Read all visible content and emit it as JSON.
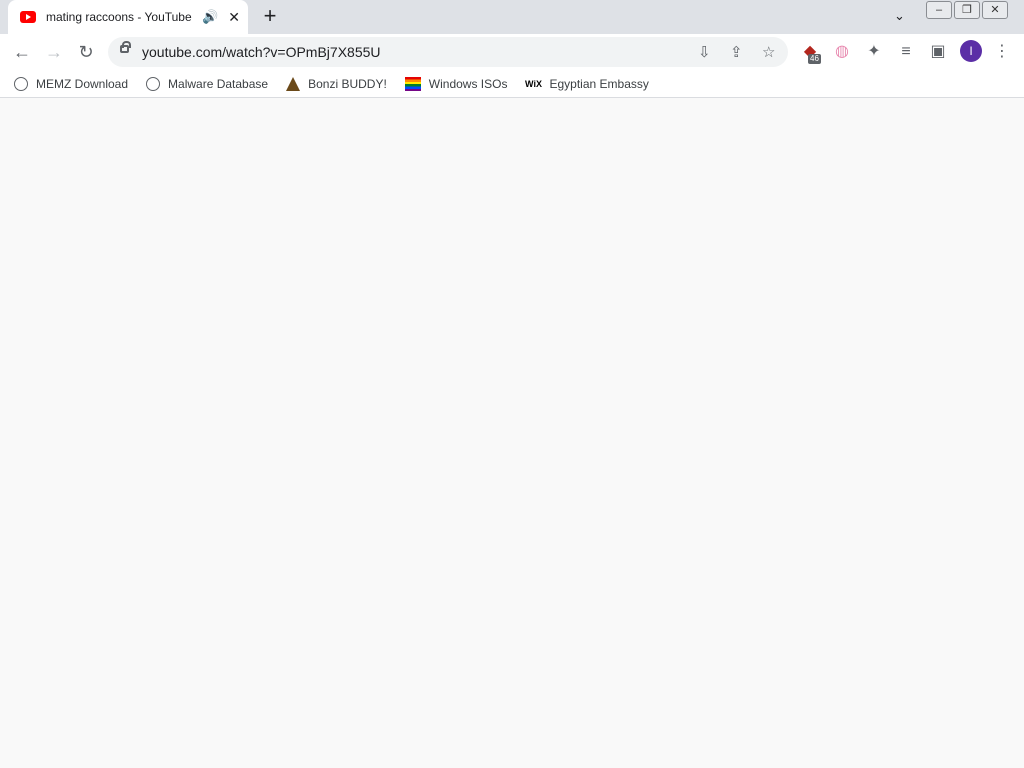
{
  "browser": {
    "tab": {
      "title": "mating raccoons - YouTube",
      "audio_icon": "speaker-icon",
      "close_glyph": "✕"
    },
    "new_tab_glyph": "+",
    "address": {
      "url": "youtube.com/watch?v=OPmBj7X855U"
    },
    "extension_badge": "46",
    "profile_initial": "I",
    "bookmarks": [
      {
        "label": "MEMZ Download",
        "icon": "globe-icon"
      },
      {
        "label": "Malware Database",
        "icon": "globe-icon"
      },
      {
        "label": "Bonzi BUDDY!",
        "icon": "bonzi-icon"
      },
      {
        "label": "Windows ISOs",
        "icon": "rainbow-flag-icon"
      },
      {
        "label": "Egyptian Embassy",
        "icon": "wix-icon",
        "icon_text": "WiX"
      }
    ]
  },
  "colors": {
    "tab_bar": "#dee1e6",
    "youtube_red": "#ff0000",
    "profile_purple": "#5b2ea6"
  }
}
